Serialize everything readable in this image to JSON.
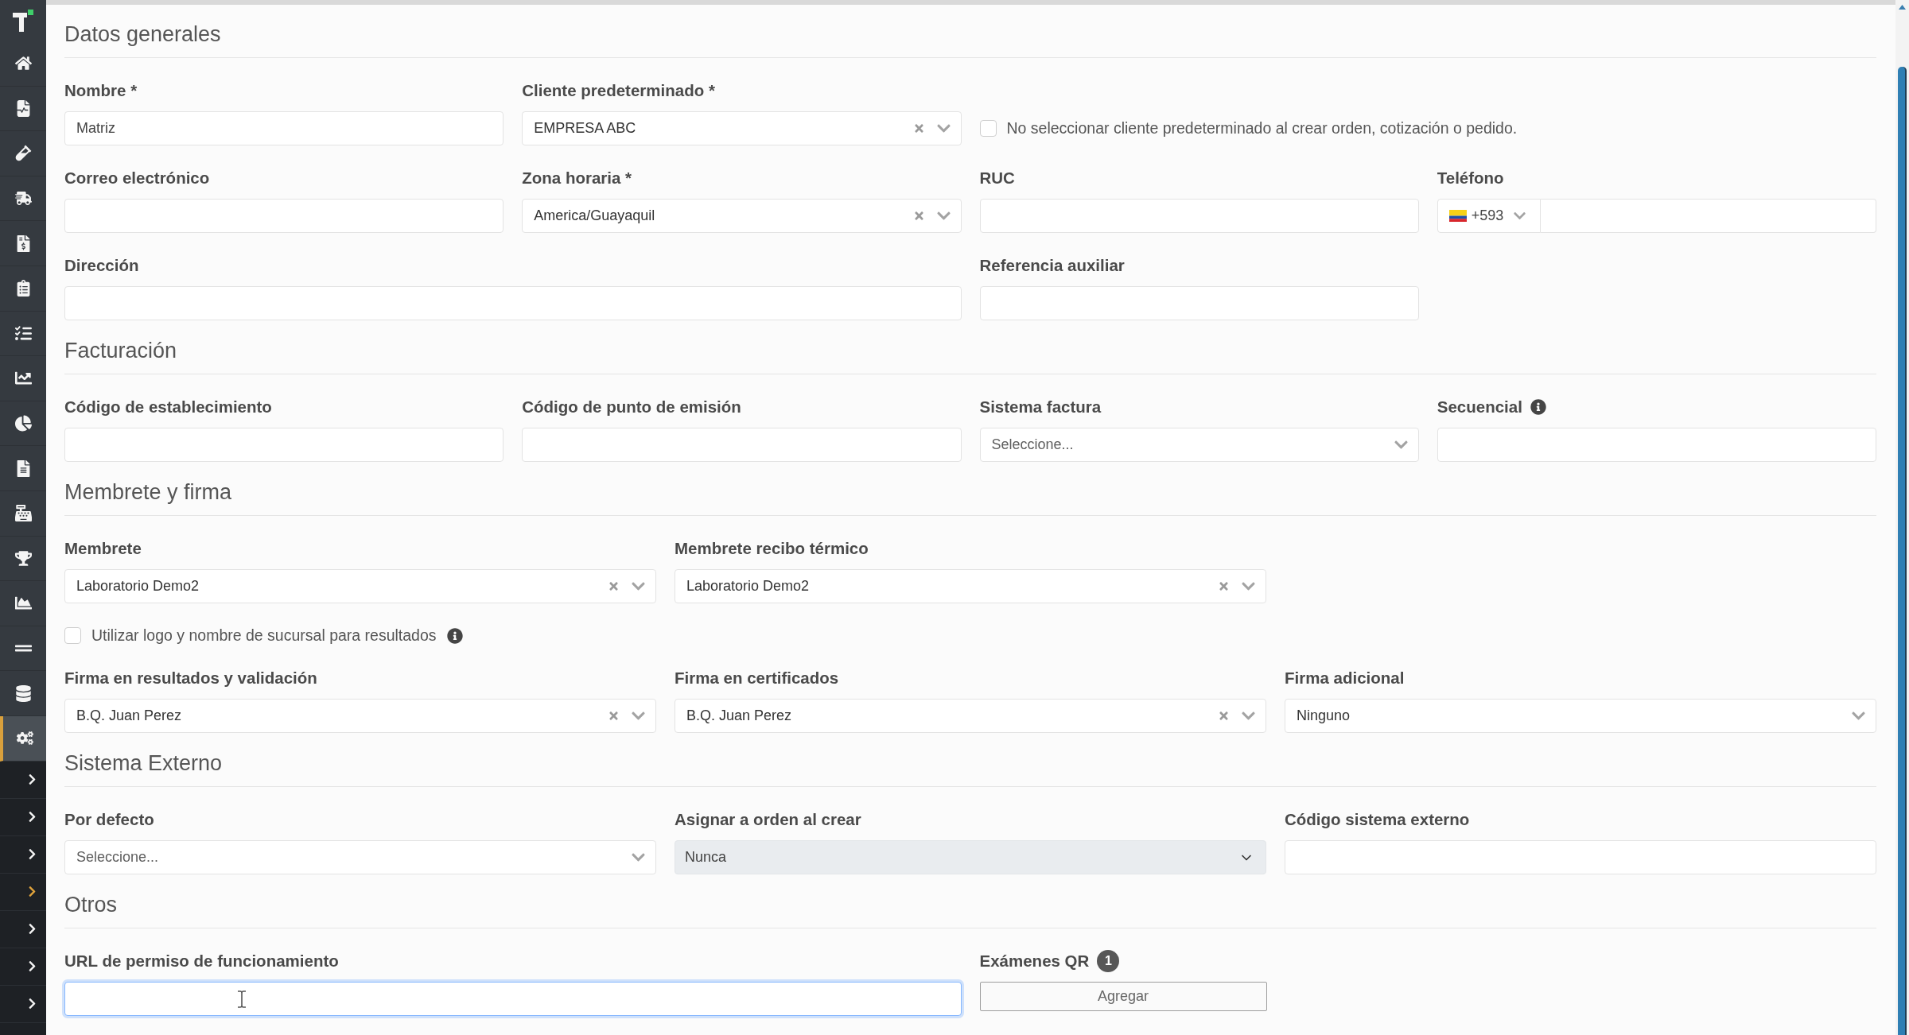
{
  "sidebar": {
    "items": [
      {
        "selected": false
      },
      {
        "selected": false
      },
      {
        "selected": false
      },
      {
        "selected": false
      },
      {
        "selected": false
      },
      {
        "selected": false
      },
      {
        "selected": false
      },
      {
        "selected": false
      },
      {
        "selected": false
      },
      {
        "selected": false
      },
      {
        "selected": false
      },
      {
        "selected": false
      },
      {
        "selected": false
      },
      {
        "selected": false
      },
      {
        "selected": false
      },
      {
        "selected": true
      }
    ],
    "submenu": [
      {
        "selected": false
      },
      {
        "selected": false
      },
      {
        "selected": false
      },
      {
        "selected": true
      },
      {
        "selected": false
      },
      {
        "selected": false
      },
      {
        "selected": false
      }
    ]
  },
  "sections": [
    {
      "title": "Datos generales",
      "rows": [
        [
          {
            "kind": "text",
            "label": "Nombre *",
            "value": "Matriz"
          },
          {
            "kind": "select",
            "label": "Cliente predeterminado *",
            "value": "EMPRESA ABC",
            "clearable": true
          },
          {
            "kind": "checkbox",
            "text": "No seleccionar cliente predeterminado al crear orden, cotización o pedido.",
            "checked": false
          }
        ],
        [
          {
            "kind": "text",
            "label": "Correo electrónico"
          },
          {
            "kind": "select",
            "label": "Zona horaria *",
            "value": "America/Guayaquil",
            "clearable": true
          },
          {
            "kind": "text",
            "label": "RUC"
          },
          {
            "kind": "phone",
            "label": "Teléfono",
            "country_code": "+593"
          }
        ],
        [
          {
            "kind": "text",
            "label": "Dirección"
          },
          "",
          {
            "kind": "text",
            "label": "Referencia auxiliar"
          }
        ]
      ]
    },
    {
      "title": "Facturación",
      "rows": [
        [
          {
            "kind": "text",
            "label": "Código de establecimiento"
          },
          {
            "kind": "text",
            "label": "Código de punto de emisión"
          },
          {
            "kind": "select",
            "label": "Sistema factura",
            "placeholder": "Seleccione..."
          },
          {
            "kind": "text",
            "label": "Secuencial",
            "info": true
          }
        ]
      ]
    },
    {
      "title": "Membrete y firma",
      "rows": [
        [
          {
            "kind": "select",
            "label": "Membrete",
            "value": "Laboratorio Demo2",
            "clearable": true
          },
          {
            "kind": "select",
            "label": "Membrete recibo térmico",
            "value": "Laboratorio Demo2",
            "clearable": true
          }
        ],
        [
          {
            "kind": "checkbox",
            "text": "Utilizar logo y nombre de sucursal para resultados",
            "checked": false,
            "info": true
          }
        ],
        [
          {
            "kind": "select",
            "label": "Firma en resultados y validación",
            "value": "B.Q. Juan Perez",
            "clearable": true
          },
          {
            "kind": "select",
            "label": "Firma en certificados",
            "value": "B.Q. Juan Perez",
            "clearable": true
          },
          {
            "kind": "select",
            "label": "Firma adicional",
            "value": "Ninguno"
          }
        ]
      ]
    },
    {
      "title": "Sistema Externo",
      "rows": [
        [
          {
            "kind": "select",
            "label": "Por defecto",
            "placeholder": "Seleccione..."
          },
          {
            "kind": "native_select",
            "label": "Asignar a orden al crear",
            "value": "Nunca",
            "disabled": true
          },
          {
            "kind": "text",
            "label": "Código sistema externo"
          }
        ]
      ]
    },
    {
      "title": "Otros",
      "rows": [
        [
          {
            "kind": "text",
            "label": "URL de permiso de funcionamiento",
            "focused": true,
            "mouse_pointer": true
          },
          {
            "kind": "button",
            "label": "Exámenes QR",
            "badge": "1",
            "button": "Agregar"
          }
        ]
      ]
    }
  ]
}
